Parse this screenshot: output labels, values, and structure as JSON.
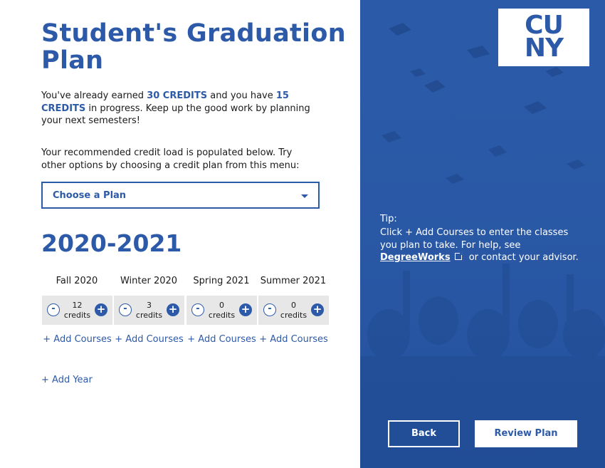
{
  "page": {
    "title": "Student's Graduation Plan"
  },
  "intro": {
    "part1": "You've already earned ",
    "earned_credits": "30 CREDITS",
    "part2": " and you have ",
    "progress_credits": "15 CREDITS",
    "part3": " in progress. Keep up the good work by planning your next semesters!"
  },
  "recommend": {
    "text": "Your recommended credit load is populated below. Try other options by choosing a credit plan from this menu:"
  },
  "plan_select": {
    "value": "Choose a Plan"
  },
  "year": {
    "label": "2020-2021",
    "semesters": [
      {
        "name": "Fall 2020",
        "credits": "12",
        "unit": "credits",
        "add_label": "+ Add Courses"
      },
      {
        "name": "Winter 2020",
        "credits": "3",
        "unit": "credits",
        "add_label": "+ Add Courses"
      },
      {
        "name": "Spring 2021",
        "credits": "0",
        "unit": "credits",
        "add_label": "+ Add Courses"
      },
      {
        "name": "Summer 2021",
        "credits": "0",
        "unit": "credits",
        "add_label": "+ Add Courses"
      }
    ],
    "minus_glyph": "-",
    "plus_glyph": "+"
  },
  "add_year": "+ Add Year",
  "sidebar": {
    "logo_line1": "CU",
    "logo_line2": "NY",
    "tip_title": "Tip:",
    "tip_part1": "Click + Add Courses to enter the classes you plan to take. For help, see ",
    "tip_link": "DegreeWorks",
    "tip_part2": " or contact your advisor.",
    "back_label": "Back",
    "review_label": "Review Plan"
  },
  "colors": {
    "brand_blue": "#2d5aa8",
    "panel_blue": "#2b5aa8",
    "credit_box": "#e7e7e7"
  }
}
